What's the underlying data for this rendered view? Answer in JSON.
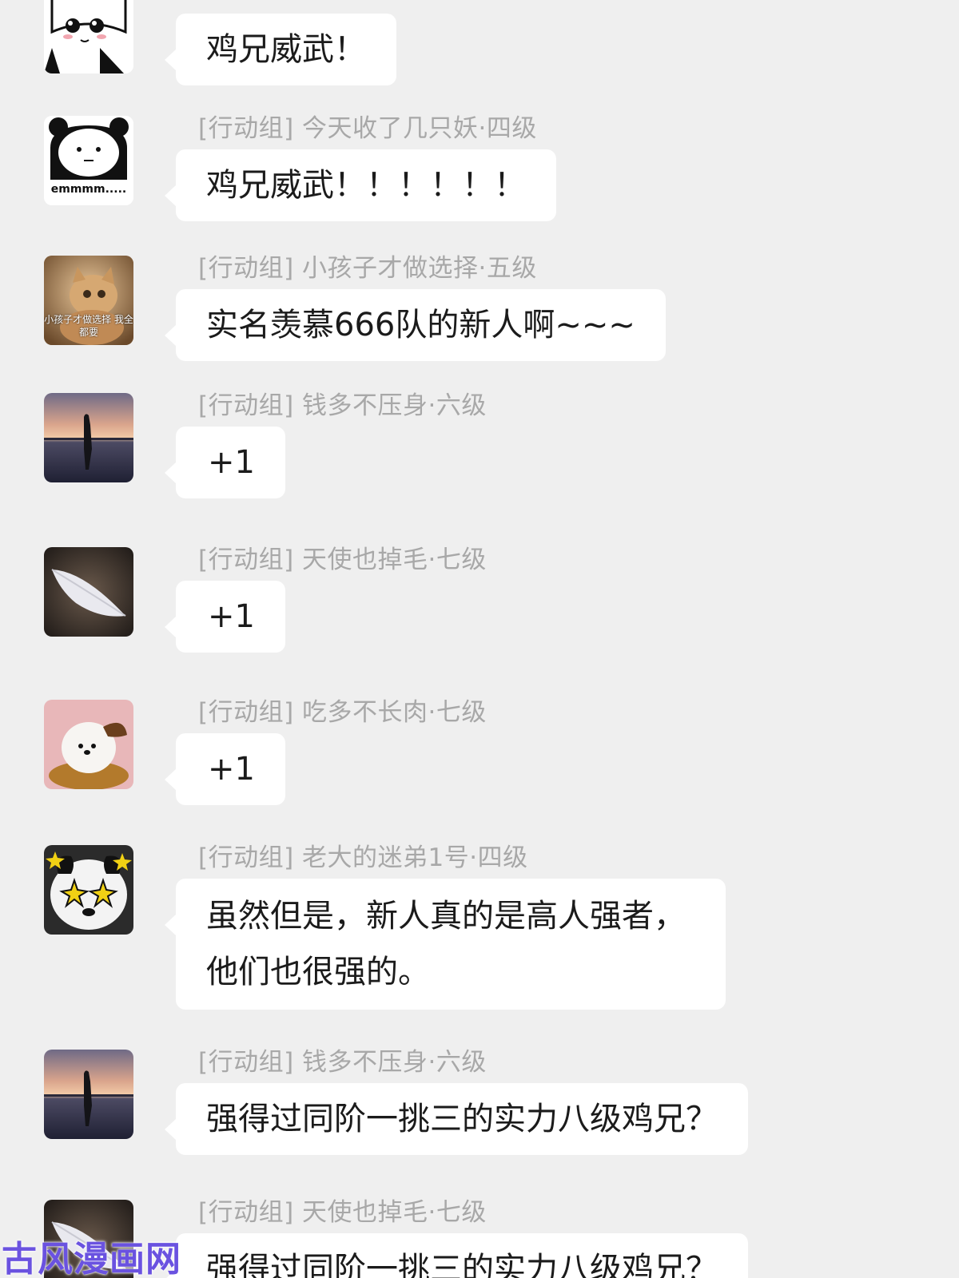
{
  "chat": {
    "messages": [
      {
        "sender": "",
        "text": "鸡兄威武！",
        "avatar": "meme-girl-avatar"
      },
      {
        "sender": "[行动组] 今天收了几只妖·四级",
        "text": "鸡兄威武！！！！！！",
        "avatar": "panda-emmm-avatar",
        "avatar_caption": "emmmm....."
      },
      {
        "sender": "[行动组] 小孩子才做选择·五级",
        "text": "实名羡慕666队的新人啊~~~",
        "avatar": "cat-avatar",
        "avatar_caption": "小孩子才做选择 我全都要"
      },
      {
        "sender": "[行动组] 钱多不压身·六级",
        "text": "+1",
        "avatar": "sunset-silhouette-avatar"
      },
      {
        "sender": "[行动组] 天使也掉毛·七级",
        "text": "+1",
        "avatar": "feather-avatar"
      },
      {
        "sender": "[行动组] 吃多不长肉·七级",
        "text": "+1",
        "avatar": "puppy-pastry-avatar"
      },
      {
        "sender": "[行动组] 老大的迷弟1号·四级",
        "text_lines": [
          "虽然但是，新人真的是高人强者，",
          "他们也很强的。"
        ],
        "avatar": "panda-stars-avatar"
      },
      {
        "sender": "[行动组] 钱多不压身·六级",
        "text": "强得过同阶一挑三的实力八级鸡兄？",
        "avatar": "sunset-silhouette-avatar"
      },
      {
        "sender": "[行动组] 天使也掉毛·七级",
        "text": "强得过同阶一挑三的实力八级鸡兄？",
        "avatar": "feather-avatar"
      }
    ]
  },
  "watermark": "古风漫画网",
  "colors": {
    "background": "#efefef",
    "bubble": "#ffffff",
    "sender_text": "#a8a8a8",
    "message_text": "#1b1b1b",
    "watermark": "#6a52e0"
  }
}
